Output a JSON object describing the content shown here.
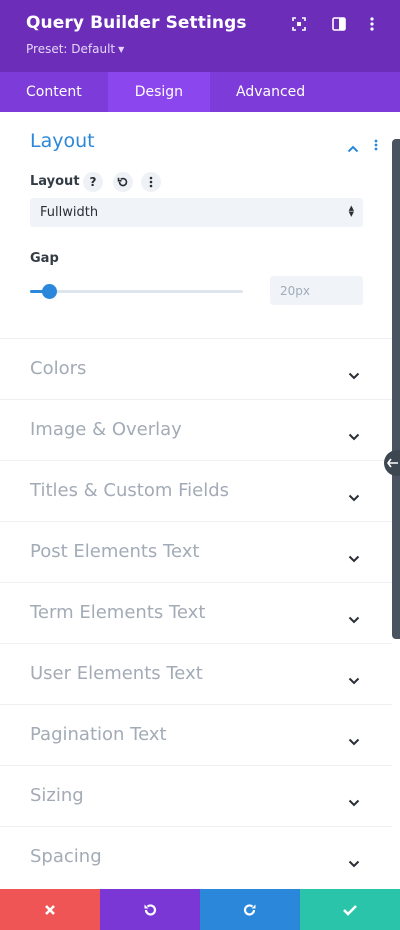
{
  "header": {
    "title": "Query Builder Settings",
    "preset_label": "Preset: Default",
    "icons": [
      "focus-icon",
      "split-view-icon",
      "kebab-menu-icon"
    ]
  },
  "tabs": [
    {
      "label": "Content",
      "active": false
    },
    {
      "label": "Design",
      "active": true
    },
    {
      "label": "Advanced",
      "active": false
    }
  ],
  "layout_panel": {
    "title": "Layout",
    "layout_field": {
      "label": "Layout",
      "help_glyph": "?",
      "value": "Fullwidth"
    },
    "gap_field": {
      "label": "Gap",
      "value": "20px",
      "slider_fraction": 0.09
    }
  },
  "sections": [
    {
      "label": "Colors"
    },
    {
      "label": "Image & Overlay"
    },
    {
      "label": "Titles & Custom Fields"
    },
    {
      "label": "Post Elements Text"
    },
    {
      "label": "Term Elements Text"
    },
    {
      "label": "User Elements Text"
    },
    {
      "label": "Pagination Text"
    },
    {
      "label": "Sizing"
    },
    {
      "label": "Spacing"
    }
  ],
  "footer": {
    "buttons": [
      {
        "name": "cancel",
        "icon": "close-icon",
        "color": "#ef5555"
      },
      {
        "name": "undo",
        "icon": "undo-icon",
        "color": "#7b36d6"
      },
      {
        "name": "redo",
        "icon": "redo-icon",
        "color": "#2b87da"
      },
      {
        "name": "save",
        "icon": "check-icon",
        "color": "#29c4a9"
      }
    ]
  },
  "colors": {
    "header_bg": "#6c2eb9",
    "tabs_bg": "#7d3bd9",
    "active_tab_bg": "#8c46ee",
    "accent_blue": "#2b87da"
  }
}
